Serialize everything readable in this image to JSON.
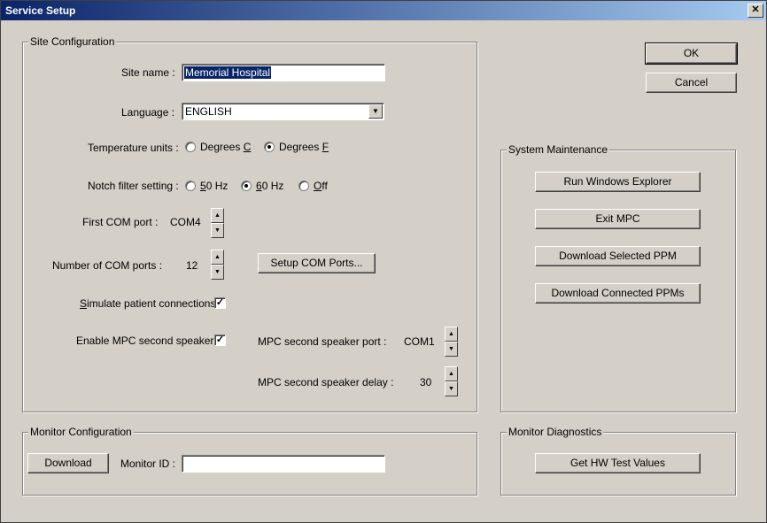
{
  "window": {
    "title": "Service Setup",
    "close_label": "✕"
  },
  "buttons": {
    "ok": "OK",
    "cancel": "Cancel"
  },
  "site": {
    "group_label": "Site Configuration",
    "site_name_label": "Site name :",
    "site_name_value": "Memorial Hospital",
    "language_label": "Language :",
    "language_value": "ENGLISH",
    "temp_label": "Temperature units :",
    "temp_c_pre": "Degrees ",
    "temp_c_key": "C",
    "temp_f_pre": "Degrees ",
    "temp_f_key": "F",
    "temp_selected": "F",
    "notch_label": "Notch filter setting :",
    "notch_50_key": "5",
    "notch_50_rest": "0 Hz",
    "notch_60_key": "6",
    "notch_60_rest": "0 Hz",
    "notch_off_key": "O",
    "notch_off_rest": "ff",
    "notch_selected": "60 Hz",
    "first_com_label": "First COM port :",
    "first_com_value": "COM4",
    "num_com_label": "Number of COM ports :",
    "num_com_value": "12",
    "setup_com_button": "Setup COM Ports...",
    "simulate_key": "S",
    "simulate_rest": "imulate patient connections :",
    "simulate_checked": true,
    "enable_mpc_label": "Enable MPC second speaker :",
    "enable_mpc_checked": true,
    "mpc_port_label": "MPC second speaker port :",
    "mpc_port_value": "COM1",
    "mpc_delay_label": "MPC second speaker delay :",
    "mpc_delay_value": "30",
    "check_mark": "✓"
  },
  "maintenance": {
    "group_label": "System Maintenance",
    "run_explorer": "Run Windows Explorer",
    "exit_mpc": "Exit MPC",
    "download_selected": "Download Selected PPM",
    "download_connected": "Download Connected PPMs"
  },
  "monitor_config": {
    "group_label": "Monitor Configuration",
    "download_button": "Download",
    "monitor_id_label": "Monitor ID :",
    "monitor_id_value": ""
  },
  "diagnostics": {
    "group_label": "Monitor Diagnostics",
    "hw_test_button": "Get HW Test Values"
  },
  "icons": {
    "dropdown": "▼",
    "spin_up": "▲",
    "spin_down": "▼"
  }
}
